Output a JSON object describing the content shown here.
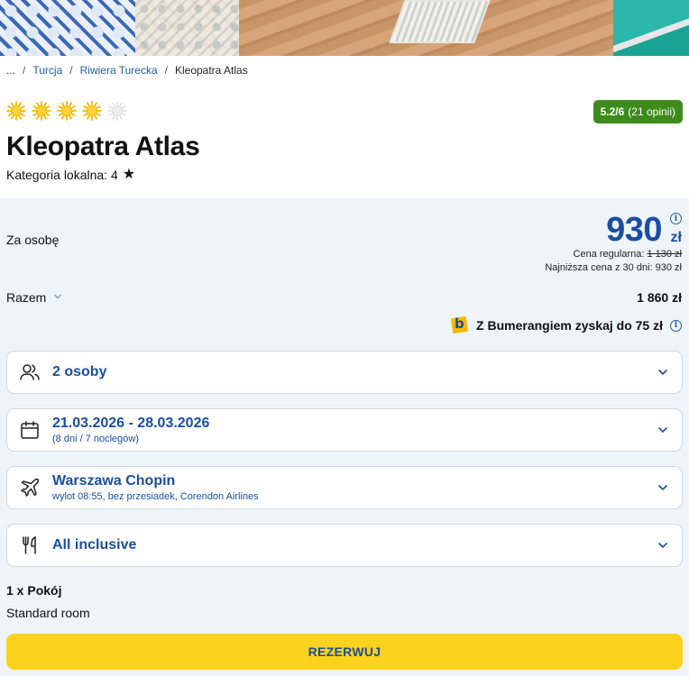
{
  "breadcrumb": {
    "ellipsis": "...",
    "separator": "/",
    "items": [
      "Turcja",
      "Riwiera Turecka",
      "Kleopatra Atlas"
    ]
  },
  "hotel": {
    "stars_filled": 4,
    "stars_total": 5,
    "name": "Kleopatra Atlas",
    "category_label": "Kategoria lokalna: 4",
    "category_icon": "star-icon"
  },
  "rating": {
    "score": "5.2/6",
    "count": "(21 opinii)",
    "color": "#3e8a1d"
  },
  "price": {
    "per_person_label": "Za osobę",
    "amount": "930",
    "currency": "zł",
    "regular_label": "Cena regularna:",
    "regular_value": "1 130 zł",
    "lowest_30_days": "Najniższa cena z 30 dni: 930 zł",
    "total_label": "Razem",
    "total_value": "1 860 zł",
    "accent_color": "#1a4fa0"
  },
  "bumerang": {
    "text": "Z Bumerangiem zyskaj do 75 zł",
    "logo_letter": "b"
  },
  "options": {
    "people": {
      "main": "2 osoby",
      "icon": "users-icon"
    },
    "dates": {
      "main": "21.03.2026 - 28.03.2026",
      "sub": "(8 dni / 7 noclegów)",
      "icon": "calendar-icon"
    },
    "flight": {
      "main": "Warszawa Chopin",
      "sub": "wylot 08:55, bez przesiadek, Corendon Airlines",
      "icon": "airplane-icon"
    },
    "board": {
      "main": "All inclusive",
      "icon": "fork-knife-icon"
    }
  },
  "room": {
    "count": "1 x Pokój",
    "name": "Standard room"
  },
  "cta": {
    "label": "REZERWUJ",
    "color": "#fcd21c"
  }
}
